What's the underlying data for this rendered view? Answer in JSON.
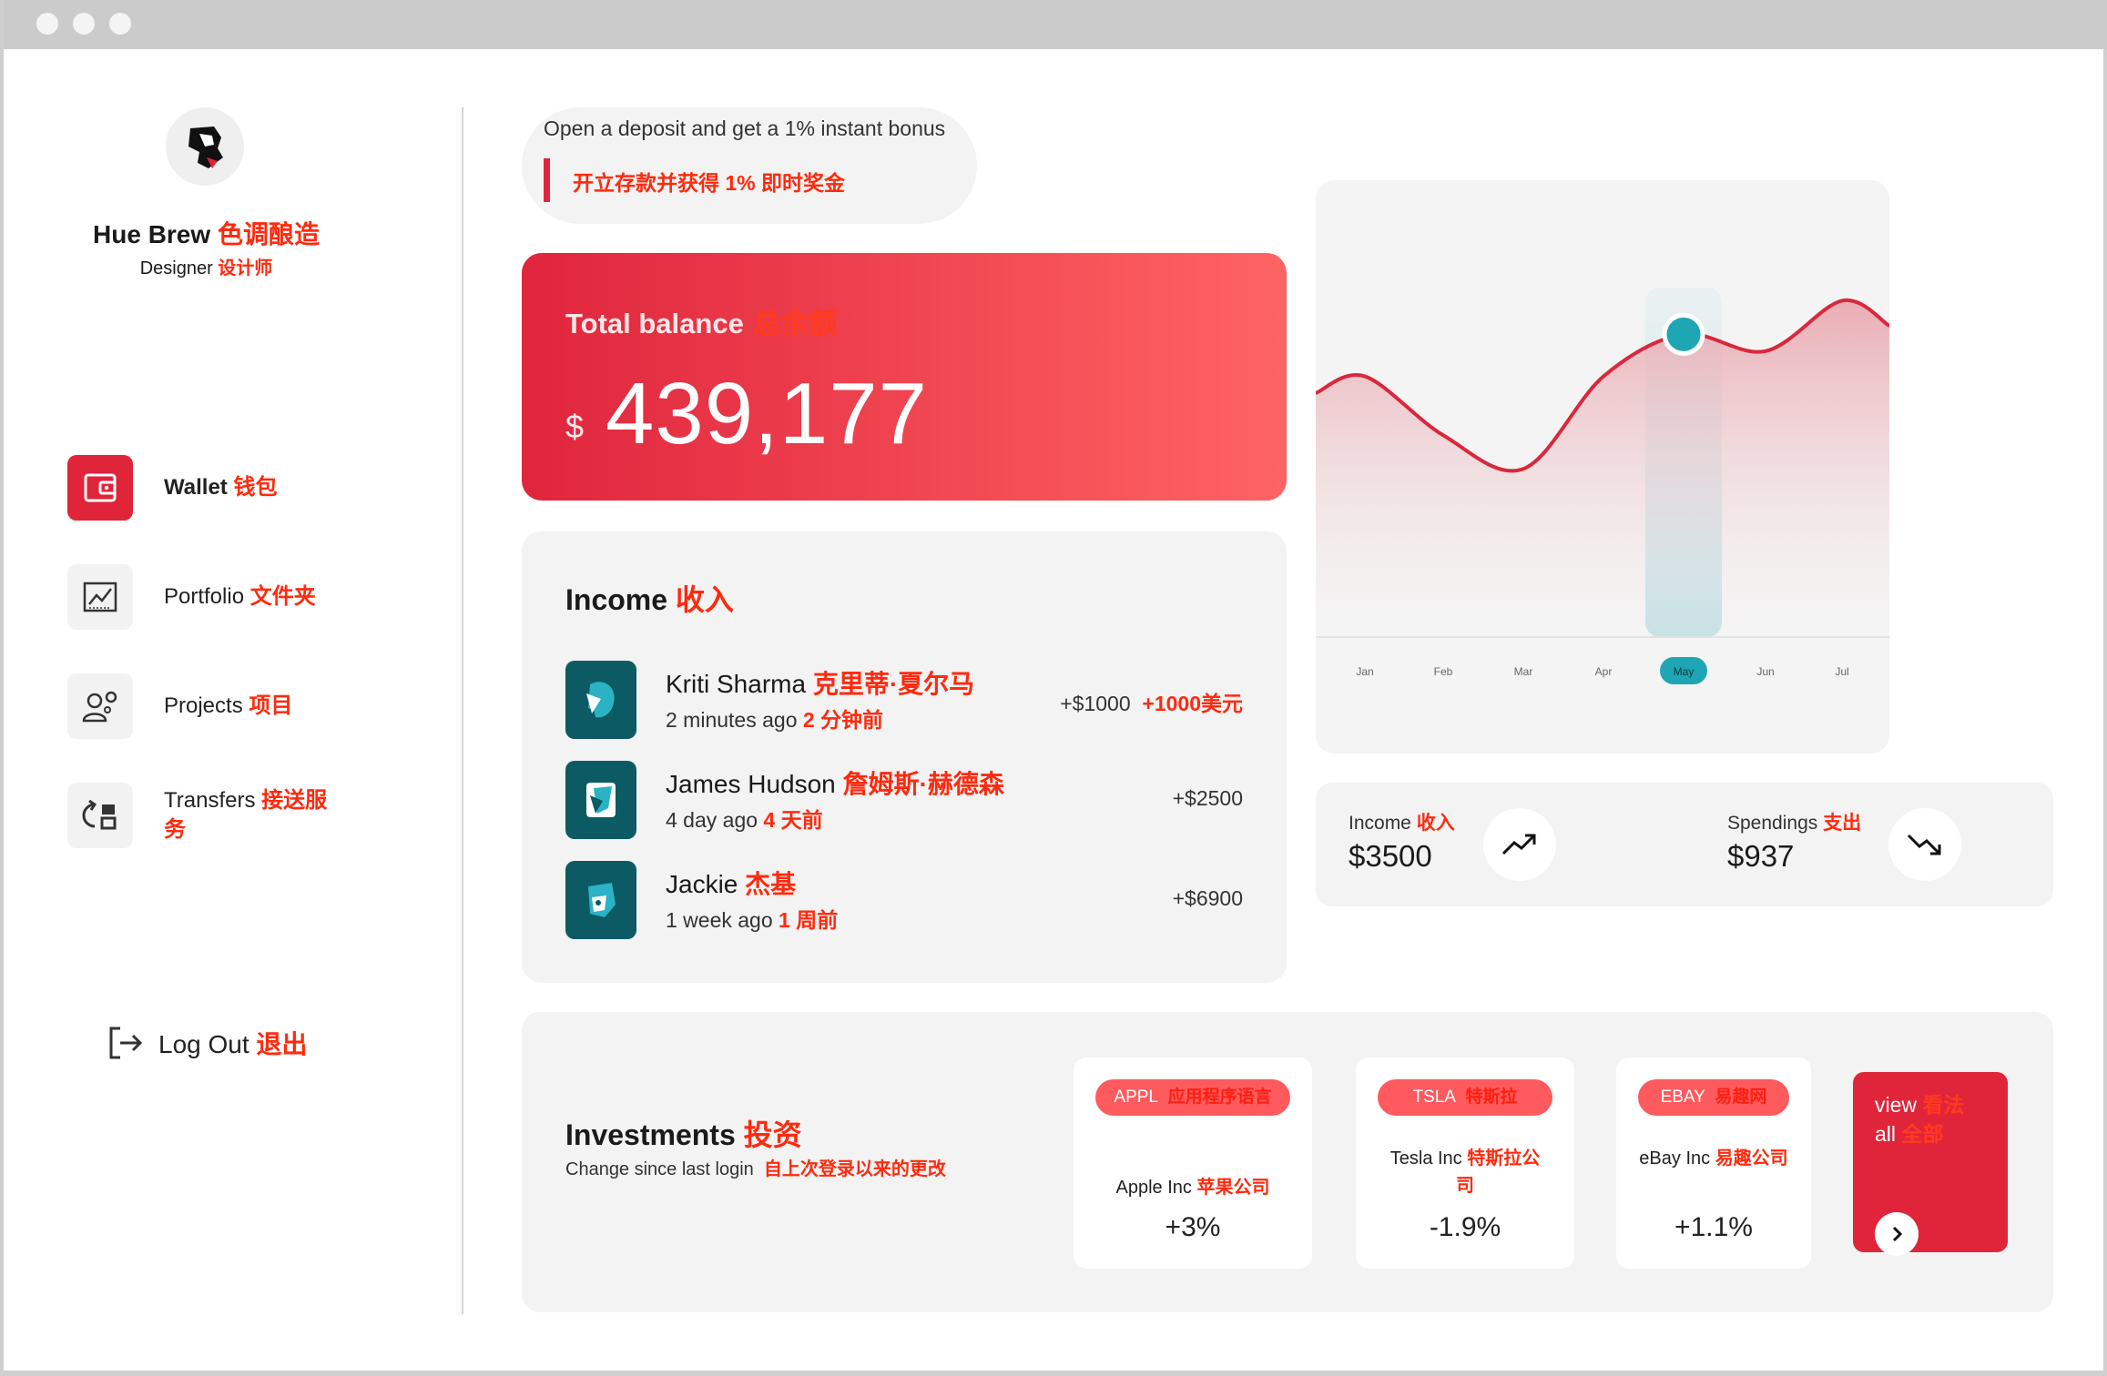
{
  "profile": {
    "name_en": "Hue Brew",
    "name_zh": "色调酿造",
    "role_en": "Designer",
    "role_zh": "设计师"
  },
  "nav": {
    "items": [
      {
        "label_en": "Wallet",
        "label_zh": "钱包",
        "icon": "wallet-icon",
        "active": true
      },
      {
        "label_en": "Portfolio",
        "label_zh": "文件夹",
        "icon": "chart-icon",
        "active": false
      },
      {
        "label_en": "Projects",
        "label_zh": "项目",
        "icon": "user-gear-icon",
        "active": false
      },
      {
        "label_en": "Transfers",
        "label_zh": "接送服务",
        "icon": "transfer-icon",
        "active": false
      }
    ],
    "logout_en": "Log Out",
    "logout_zh": "退出"
  },
  "promo": {
    "text_en": "Open a deposit and get a 1% instant bonus",
    "text_zh": "开立存款并获得 1% 即时奖金"
  },
  "balance": {
    "title_en": "Total balance",
    "title_zh": "总余额",
    "currency": "$",
    "amount": "439,177"
  },
  "income": {
    "title_en": "Income",
    "title_zh": "收入",
    "transactions": [
      {
        "name_en": "Kriti Sharma",
        "name_zh": "克里蒂·夏尔马",
        "time_en": "2 minutes ago",
        "time_zh": "2 分钟前",
        "amount": "+$1000",
        "amount_zh": "+1000美元"
      },
      {
        "name_en": "James Hudson",
        "name_zh": "詹姆斯·赫德森",
        "time_en": "4 day ago",
        "time_zh": "4 天前",
        "amount": "+$2500",
        "amount_zh": ""
      },
      {
        "name_en": "Jackie",
        "name_zh": "杰基",
        "time_en": "1 week ago",
        "time_zh": "1 周前",
        "amount": "+$6900",
        "amount_zh": ""
      }
    ]
  },
  "chart_data": {
    "type": "area",
    "categories": [
      "Jan",
      "Feb",
      "Mar",
      "Apr",
      "May",
      "Jun",
      "Jul"
    ],
    "values": [
      62,
      48,
      40,
      62,
      72,
      68,
      80
    ],
    "highlighted": "May",
    "colors": {
      "line": "#d9283c",
      "highlight_point": "#1fa6b4",
      "highlight_band": "#c9e2e6"
    },
    "grid": false
  },
  "stats": {
    "income_label_en": "Income",
    "income_label_zh": "收入",
    "income_value": "$3500",
    "spend_label_en": "Spendings",
    "spend_label_zh": "支出",
    "spend_value": "$937"
  },
  "investments": {
    "title_en": "Investments",
    "title_zh": "投资",
    "subtitle_en": "Change since last login",
    "subtitle_zh": "自上次登录以来的更改",
    "stocks": [
      {
        "ticker": "APPL",
        "ticker_zh": "应用程序语言",
        "name_en": "Apple Inc",
        "name_zh": "苹果公司",
        "change": "+3%"
      },
      {
        "ticker": "TSLA",
        "ticker_zh": "特斯拉",
        "name_en": "Tesla Inc",
        "name_zh": "特斯拉公司",
        "change": "-1.9%"
      },
      {
        "ticker": "EBAY",
        "ticker_zh": "易趣网",
        "name_en": "eBay Inc",
        "name_zh": "易趣公司",
        "change": "+1.1%"
      }
    ],
    "view_all_en_1": "view",
    "view_all_zh_1": "看法",
    "view_all_en_2": "all",
    "view_all_zh_2": "全部"
  },
  "colors": {
    "accent": "#e0243a",
    "zh_text": "#ff2a0e",
    "teal": "#0b5a64"
  }
}
